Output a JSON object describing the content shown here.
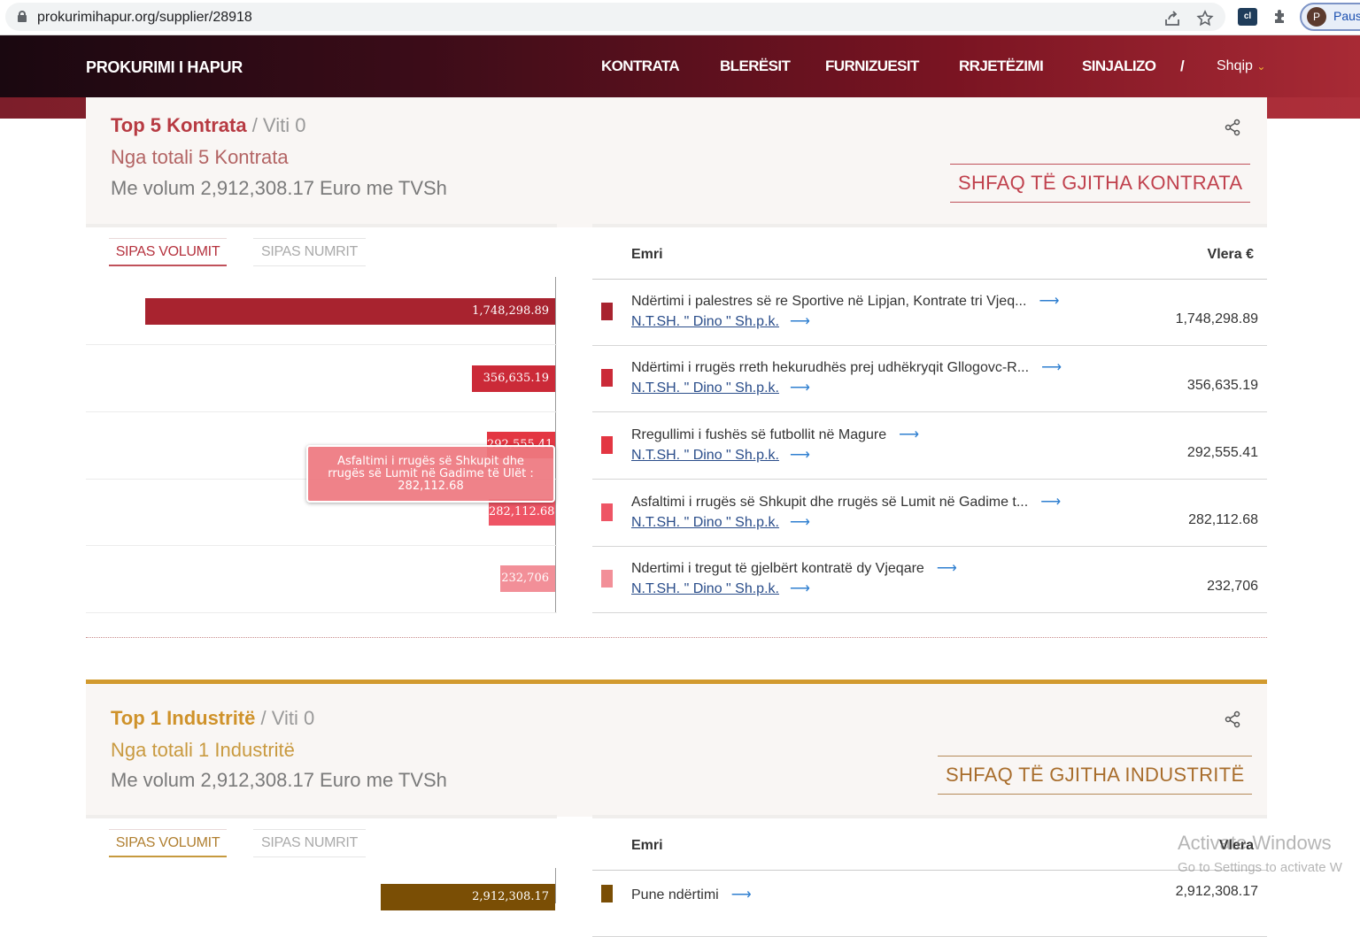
{
  "browser": {
    "url": "prokurimihapur.org/supplier/28918",
    "profile_initial": "P",
    "profile_label": "Paus"
  },
  "nav": {
    "brand": "PROKURIMI I HAPUR",
    "items": [
      "KONTRATA",
      "BLERËSIT",
      "FURNIZUESIT",
      "RRJETËZIMI",
      "SINJALIZO",
      "/"
    ],
    "language": "Shqip",
    "language_icon": "chevron-down-icon"
  },
  "contracts": {
    "title_bold": "Top 5 Kontrata",
    "title_rest": " / Viti 0",
    "subtitle": "Nga totali 5 Kontrata",
    "volume": "Me volum 2,912,308.17 Euro me TVSh",
    "show_all": "SHFAQ TË GJITHA KONTRATA",
    "tab_volume": "SIPAS VOLUMIT",
    "tab_count": "SIPAS NUMRIT",
    "col_name": "Emri",
    "col_value": "Vlera €",
    "tooltip": {
      "line1": "Asfaltimi i rrugës së Shkupit dhe",
      "line2": "rrugës së Lumit në Gadime të Ulët :",
      "line3": "282,112.68"
    },
    "rows": [
      {
        "name": "Ndërtimi i palestres së re Sportive në Lipjan, Kontrate tri Vjeq...",
        "supplier": "N.T.SH. \" Dino \" Sh.p.k.",
        "value": "1,748,298.89",
        "color": "#a8232f"
      },
      {
        "name": "Ndërtimi i rrugës rreth hekurudhës prej udhëkryqit Gllogovc-R...",
        "supplier": "N.T.SH. \" Dino \" Sh.p.k.",
        "value": "356,635.19",
        "color": "#cb2a38"
      },
      {
        "name": "Rregullimi i fushës së futbollit në Magure",
        "supplier": "N.T.SH. \" Dino \" Sh.p.k.",
        "value": "292,555.41",
        "color": "#e33642"
      },
      {
        "name": "Asfaltimi i rrugës së Shkupit dhe rrugës së Lumit në Gadime t...",
        "supplier": "N.T.SH. \" Dino \" Sh.p.k.",
        "value": "282,112.68",
        "color": "#ee5565"
      },
      {
        "name": "Ndertimi i tregut të gjelbërt kontratë dy Vjeqare",
        "supplier": "N.T.SH. \" Dino \" Sh.p.k.",
        "value": "232,706",
        "color": "#f28f98"
      }
    ]
  },
  "chart_data": {
    "type": "bar",
    "orientation": "horizontal",
    "categories": [
      "Ndërtimi i palestres së re Sportive në Lipjan, Kontrate tri Vjeq...",
      "Ndërtimi i rrugës rreth hekurudhës prej udhëkryqit Gllogovc-R...",
      "Rregullimi i fushës së futbollit në Magure",
      "Asfaltimi i rrugës së Shkupit dhe rrugës së Lumit në Gadime t...",
      "Ndertimi i tregut të gjelbërt kontratë dy Vjeqare"
    ],
    "values": [
      1748298.89,
      356635.19,
      292555.41,
      282112.68,
      232706
    ],
    "value_labels": [
      "1,748,298.89",
      "356,635.19",
      "292,555.41",
      "282,112.68",
      "232,706"
    ],
    "colors": [
      "#a8232f",
      "#cb2a38",
      "#e33642",
      "#ee5565",
      "#f28f98"
    ],
    "xlim": [
      0,
      1748298.89
    ],
    "bar_direction": "right-to-left"
  },
  "industries": {
    "title_bold": "Top 1 Industritë",
    "title_rest": " / Viti 0",
    "subtitle": "Nga totali 1 Industritë",
    "volume": "Me volum 2,912,308.17 Euro me TVSh",
    "show_all": "SHFAQ TË GJITHA INDUSTRITË",
    "tab_volume": "SIPAS VOLUMIT",
    "tab_count": "SIPAS NUMRIT",
    "col_name": "Emri",
    "col_value": "Vlera",
    "row": {
      "name": "Pune ndërtimi",
      "value": "2,912,308.17",
      "color": "#7a4e05"
    },
    "bar_label": "2,912,308.17"
  },
  "watermark": {
    "line1": "Activate Windows",
    "line2": "Go to Settings to activate W"
  }
}
